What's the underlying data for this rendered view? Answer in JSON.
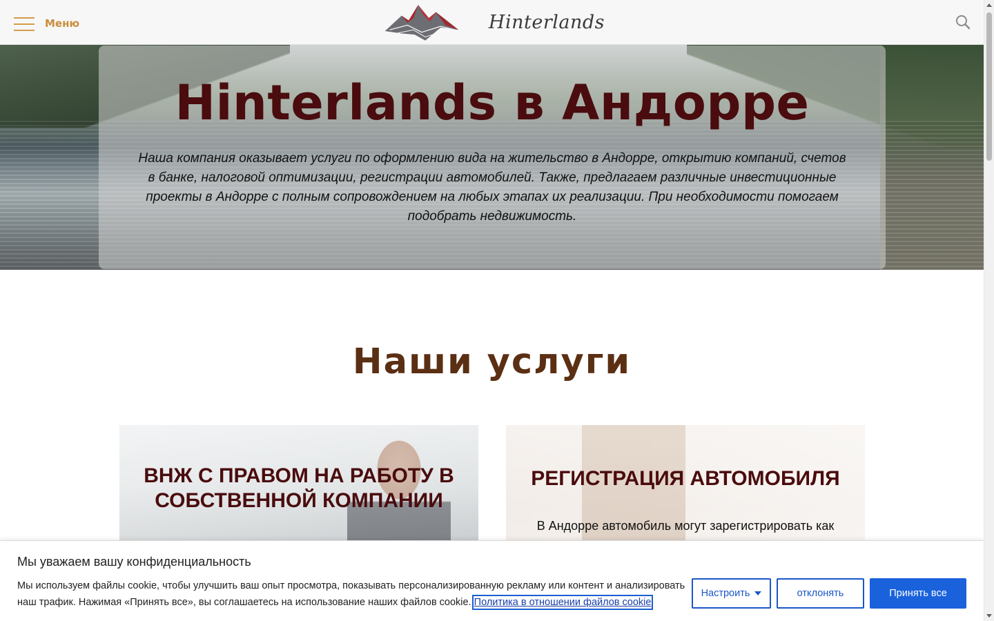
{
  "header": {
    "menu_label": "Меню",
    "logo_text": "Hinterlands",
    "icons": {
      "menu": "hamburger-icon",
      "logo": "mountain-logo-icon",
      "search": "search-icon"
    },
    "accent_color": "#c98d3c"
  },
  "hero": {
    "title": "Hinterlands в Андорре",
    "description": "Наша компания оказывает услуги по оформлению вида на жительство в Андорре, открытию компаний, счетов в банке, налоговой оптимизации, регистрации автомобилей. Также, предлагаем различные инвестиционные проекты в Андорре с полным сопровождением на любых этапах их реализации. При необходимости помогаем подобрать недвижимость.",
    "title_color": "#4a0c0e"
  },
  "services": {
    "title": "Наши услуги",
    "cards": [
      {
        "title": "ВНЖ С ПРАВОМ НА РАБОТУ В СОБСТВЕННОЙ КОМПАНИИ",
        "text": ""
      },
      {
        "title": "РЕГИСТРАЦИЯ АВТОМОБИЛЯ",
        "text": "В Андорре автомобиль могут зарегистрировать как"
      }
    ]
  },
  "cookie_banner": {
    "title": "Мы уважаем вашу конфиденциальность",
    "text": "Мы используем файлы cookie, чтобы улучшить ваш опыт просмотра, показывать персонализированную рекламу или контент и анализировать наш трафик. Нажимая «Принять все», вы соглашаетесь на использование наших файлов cookie.",
    "policy_link": "Политика в отношении файлов cookie",
    "buttons": {
      "customize": "Настроить",
      "reject": "отклонять",
      "accept": "Принять все"
    },
    "accent_color": "#1a62dc"
  }
}
